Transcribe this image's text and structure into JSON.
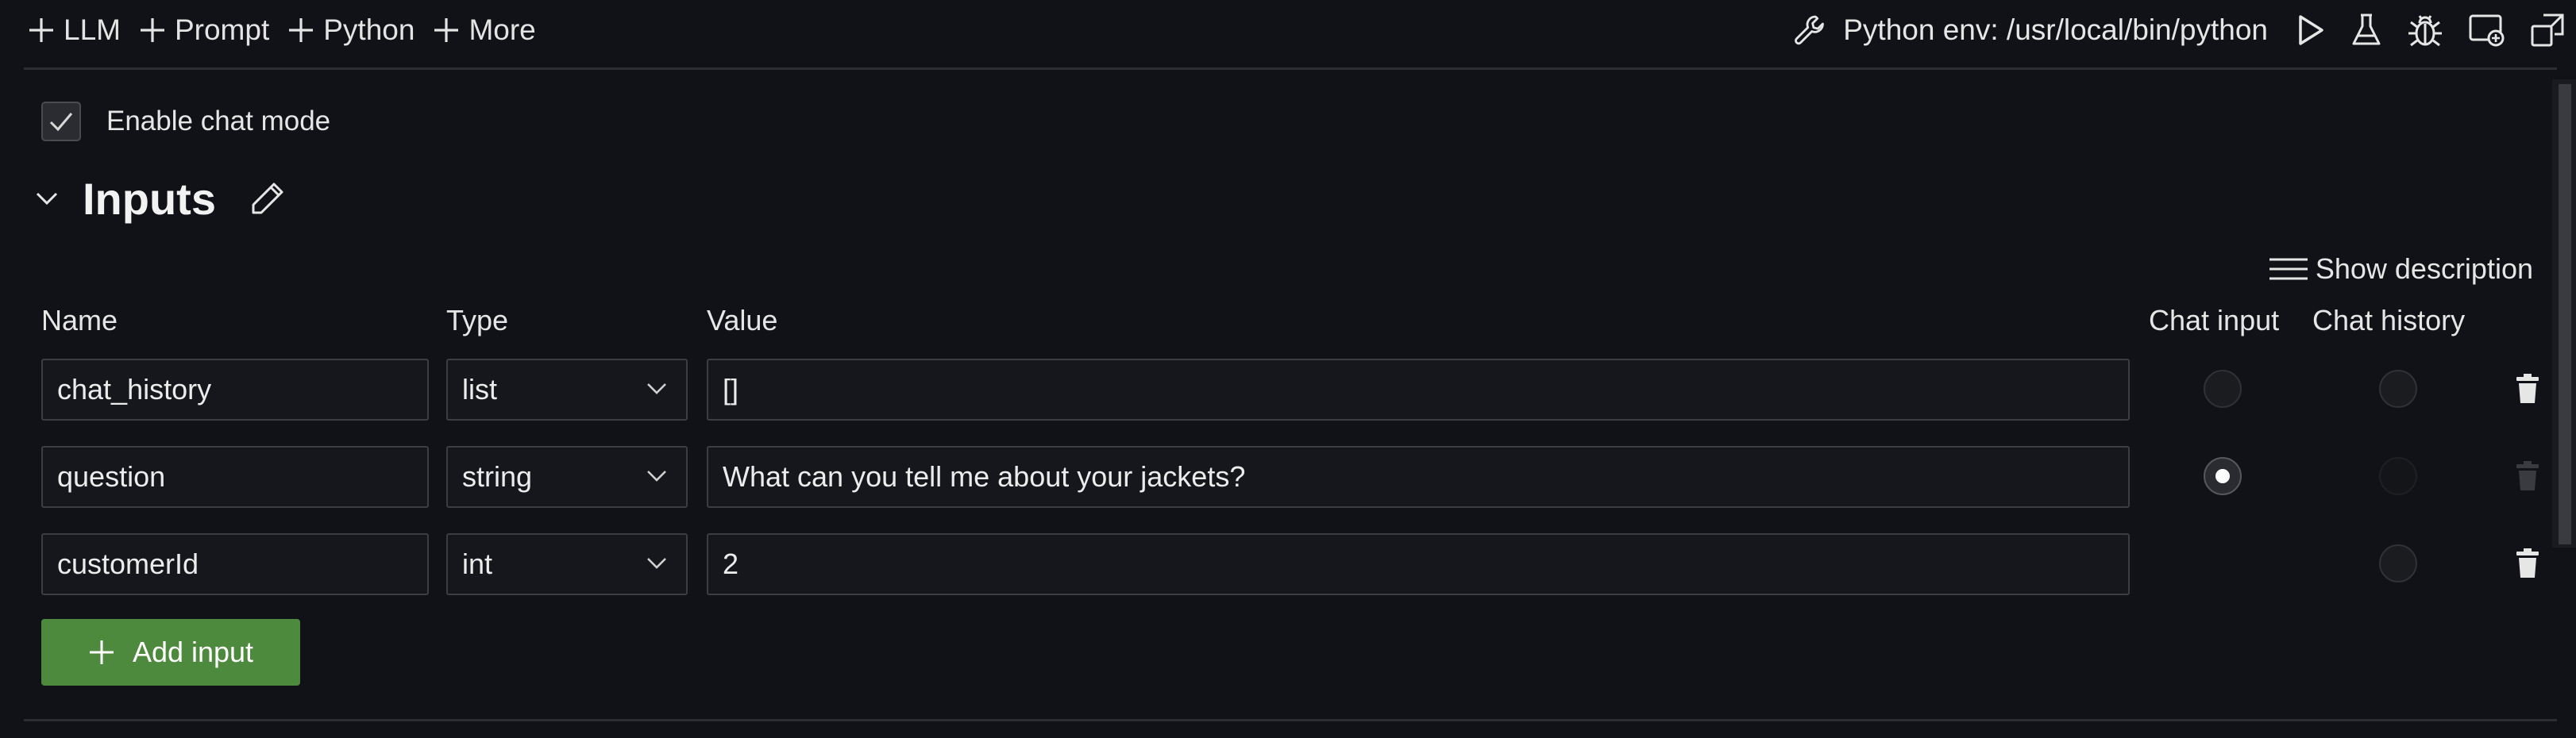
{
  "toolbar": {
    "add_items": [
      {
        "label": "LLM",
        "icon": "plus-icon"
      },
      {
        "label": "Prompt",
        "icon": "plus-icon"
      },
      {
        "label": "Python",
        "icon": "plus-icon"
      },
      {
        "label": "More",
        "icon": "plus-icon"
      }
    ],
    "python_env": "Python env: /usr/local/bin/python",
    "right_icons": [
      "wrench-icon",
      "run-icon",
      "flask-icon",
      "bug-icon",
      "layout-icon",
      "popout-icon"
    ]
  },
  "chat_mode": {
    "label": "Enable chat mode",
    "checked": true
  },
  "inputs_section": {
    "title": "Inputs",
    "show_description_label": "Show description",
    "columns": {
      "name": "Name",
      "type": "Type",
      "value": "Value",
      "chat_input": "Chat input",
      "chat_history": "Chat history"
    },
    "rows": [
      {
        "name": "chat_history",
        "type": "list",
        "value": "[]",
        "chat_input": "unselected",
        "chat_history": "unselected",
        "delete_enabled": true
      },
      {
        "name": "question",
        "type": "string",
        "value": "What can you tell me about your jackets?",
        "chat_input": "selected",
        "chat_history": "disabled",
        "delete_enabled": false
      },
      {
        "name": "customerId",
        "type": "int",
        "value": "2",
        "chat_input": "hidden",
        "chat_history": "unselected",
        "delete_enabled": true
      }
    ],
    "add_button_label": "Add input"
  },
  "colors": {
    "background": "#111217",
    "field_border": "#3c3d42",
    "add_button": "#4e8a3e",
    "text": "#e6e6e6"
  }
}
